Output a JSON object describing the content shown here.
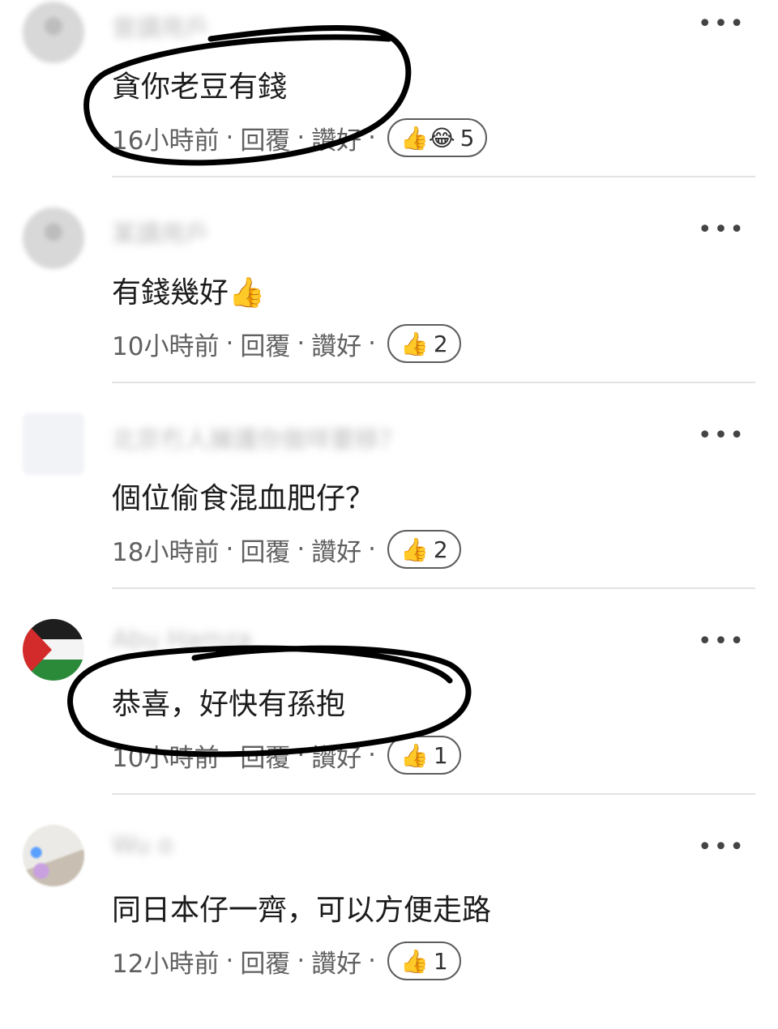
{
  "comments": [
    {
      "name": "曾讀用戶",
      "text": "貪你老豆有錢",
      "time": "16小時前",
      "reply": "回覆",
      "like": "讚好",
      "reactions": "👍😂",
      "count": "5"
    },
    {
      "name": "某讀用戶",
      "text": "有錢幾好👍",
      "time": "10小時前",
      "reply": "回覆",
      "like": "讚好",
      "reactions": "👍",
      "count": "2"
    },
    {
      "name": "北京冇人擁護你做咩要移？",
      "text": "個位偷食混血肥仔？",
      "time": "18小時前",
      "reply": "回覆",
      "like": "讚好",
      "reactions": "👍",
      "count": "2"
    },
    {
      "name": "Abu Hamza",
      "text": "恭喜，好快有孫抱",
      "time": "10小時前",
      "reply": "回覆",
      "like": "讚好",
      "reactions": "👍",
      "count": "1"
    },
    {
      "name": "Wu o",
      "text": "同日本仔一齊，可以方便走路",
      "time": "12小時前",
      "reply": "回覆",
      "like": "讚好",
      "reactions": "👍",
      "count": "1"
    }
  ],
  "icons": {
    "more": "more-horizontal-icon",
    "like": "thumbs-up-emoji",
    "laugh": "laughing-emoji"
  },
  "colors": {
    "meta": "#606060",
    "divider": "#e3e3e3",
    "scribble": "#000000"
  }
}
